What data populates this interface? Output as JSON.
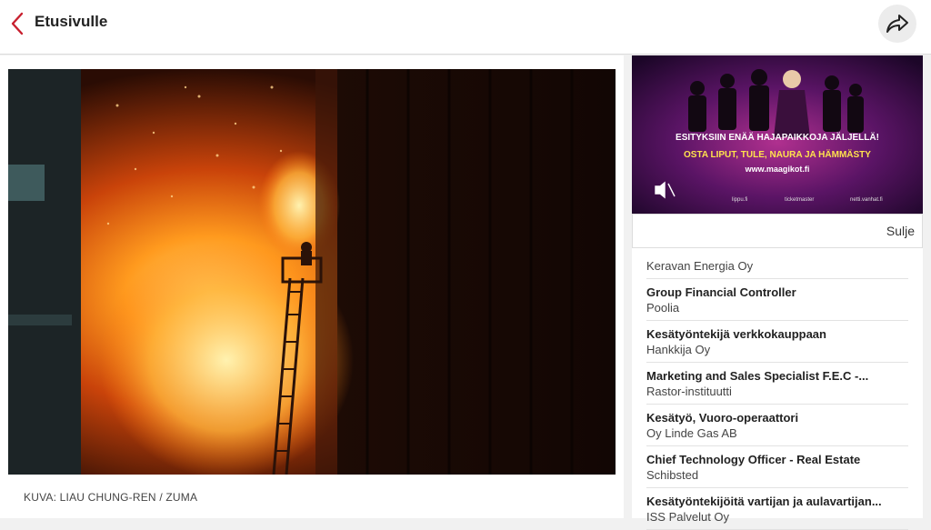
{
  "header": {
    "back_label": "Etusivulle"
  },
  "article": {
    "photo_caption": "KUVA: LIAU CHUNG-REN / ZUMA"
  },
  "ad": {
    "headline": "ESITYKSIIN ENÄÄ HAJAPAIKKOJA JÄLJELLÄ!",
    "subline": "OSTA LIPUT, TULE, NAURA JA HÄMMÄSTY",
    "url": "www.maagikot.fi",
    "sponsor_1": "lippu.fi",
    "sponsor_2": "ticketmaster",
    "sponsor_3": "netti.vanhat.fi",
    "close_label": "Sulje"
  },
  "jobs": [
    {
      "title": "",
      "company": "Keravan Energia Oy"
    },
    {
      "title": "Group Financial Controller",
      "company": "Poolia"
    },
    {
      "title": "Kesätyöntekijä verkkokauppaan",
      "company": "Hankkija Oy"
    },
    {
      "title": "Marketing and Sales Specialist F.E.C -...",
      "company": "Rastor-instituutti"
    },
    {
      "title": "Kesätyö, Vuoro-operaattori",
      "company": "Oy Linde Gas AB"
    },
    {
      "title": "Chief Technology Officer - Real Estate",
      "company": "Schibsted"
    },
    {
      "title": "Kesätyöntekijöitä vartijan ja aulavartijan...",
      "company": "ISS Palvelut Oy"
    }
  ]
}
